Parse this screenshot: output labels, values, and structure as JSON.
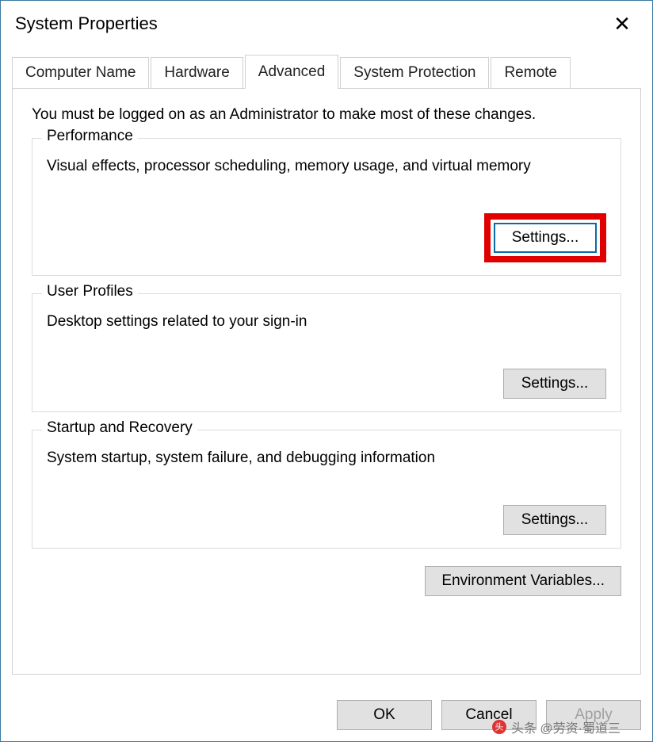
{
  "window": {
    "title": "System Properties"
  },
  "tabs": {
    "computer_name": "Computer Name",
    "hardware": "Hardware",
    "advanced": "Advanced",
    "system_protection": "System Protection",
    "remote": "Remote",
    "active": "advanced"
  },
  "advanced_page": {
    "intro": "You must be logged on as an Administrator to make most of these changes.",
    "performance": {
      "legend": "Performance",
      "desc": "Visual effects, processor scheduling, memory usage, and virtual memory",
      "button": "Settings..."
    },
    "user_profiles": {
      "legend": "User Profiles",
      "desc": "Desktop settings related to your sign-in",
      "button": "Settings..."
    },
    "startup_recovery": {
      "legend": "Startup and Recovery",
      "desc": "System startup, system failure, and debugging information",
      "button": "Settings..."
    },
    "env_vars_button": "Environment Variables..."
  },
  "bottom": {
    "ok": "OK",
    "cancel": "Cancel",
    "apply": "Apply"
  },
  "watermark": "头条 @劳资·蜀道三"
}
